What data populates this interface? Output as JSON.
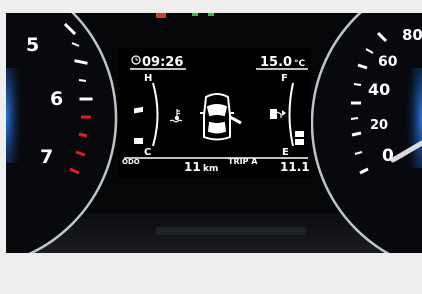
{
  "left_gauge": {
    "labels": [
      "5",
      "6",
      "7"
    ]
  },
  "right_gauge": {
    "labels": [
      "80",
      "60",
      "40",
      "20",
      "0"
    ]
  },
  "display": {
    "clock": "09:26",
    "outside_temp": "15.0",
    "temp_unit": "°C",
    "coolant_high": "H",
    "coolant_cold": "C",
    "fuel_full": "F",
    "fuel_empty": "E",
    "odo_label": "ODO",
    "distance_value": "11",
    "distance_unit": "km",
    "trip_label": "TRIP A",
    "trip_value": "11.1"
  },
  "colors": {
    "display_text": "#ffffff",
    "gauge_ring": "#4aa3ff",
    "redline": "#e02020",
    "warning_top": "#d04020",
    "indicator_green": "#30c040"
  },
  "icons": [
    "clock-icon",
    "coolant-temperature-icon",
    "car-door-open-icon",
    "fuel-pump-icon",
    "clock-icon"
  ]
}
